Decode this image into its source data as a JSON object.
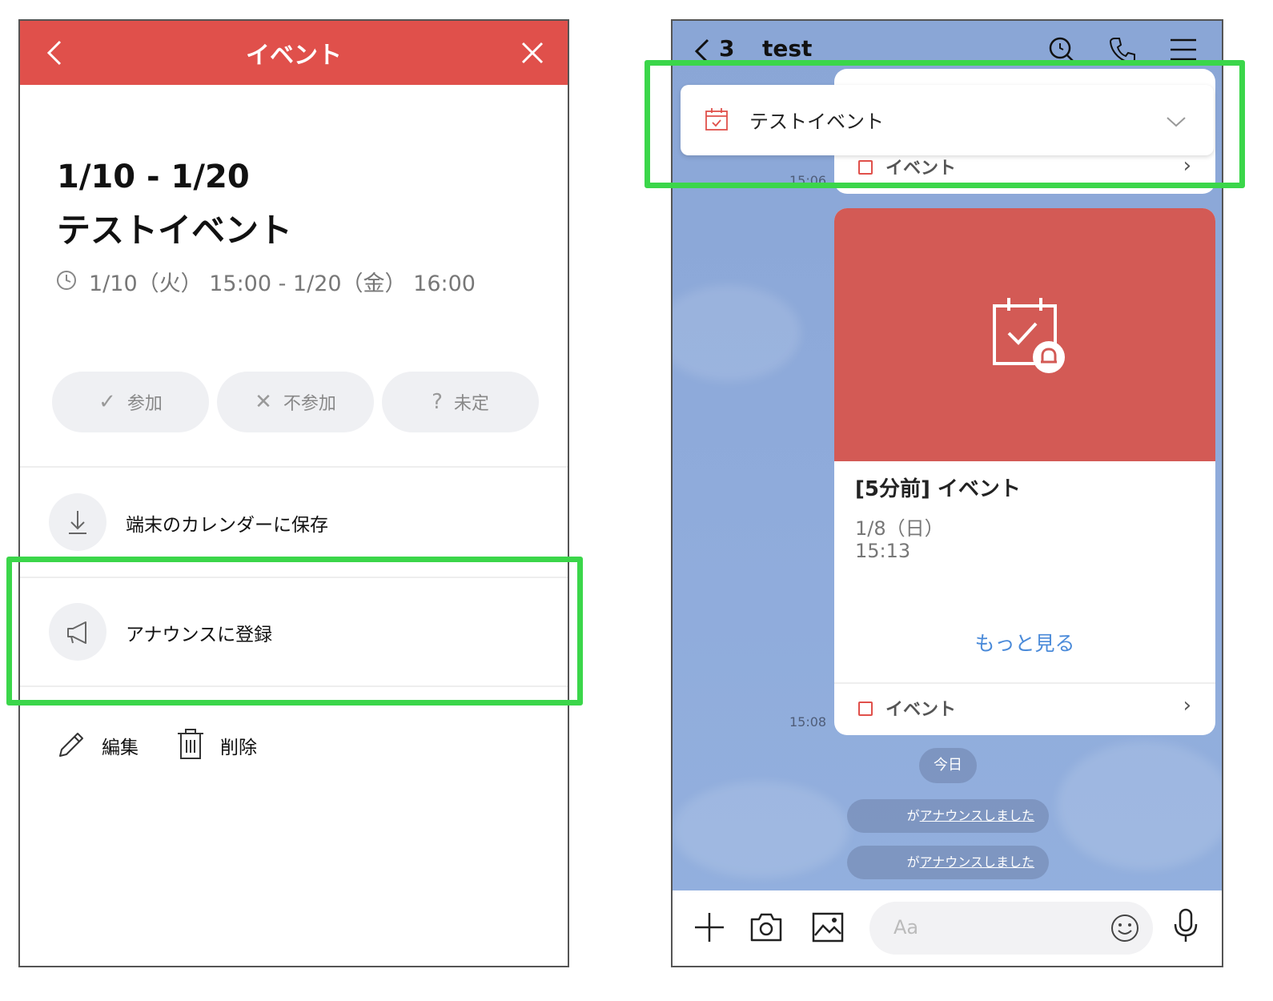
{
  "left": {
    "header": {
      "title": "イベント"
    },
    "event": {
      "date_range": "1/10 - 1/20",
      "title": "テストイベント",
      "datetime": "1/10（火） 15:00 - 1/20（金） 16:00"
    },
    "rsvp": [
      {
        "icon": "check-icon",
        "glyph": "✓",
        "label": "参加"
      },
      {
        "icon": "x-icon",
        "glyph": "✕",
        "label": "不参加"
      },
      {
        "icon": "question-icon",
        "glyph": "?",
        "label": "未定"
      }
    ],
    "actions": {
      "save_calendar": "端末のカレンダーに保存",
      "announce": "アナウンスに登録"
    },
    "footer": {
      "edit": "編集",
      "delete": "削除"
    }
  },
  "right": {
    "header": {
      "back_count": "3",
      "chat_name": "test"
    },
    "pinned": {
      "title": "テストイベント"
    },
    "top_bubble": {
      "timestamp": "15:06",
      "link": "イベント"
    },
    "card": {
      "title": "[5分前] イベント",
      "date": "1/8（日）",
      "time": "15:13",
      "more": "もっと見る",
      "link": "イベント",
      "timestamp": "15:08"
    },
    "today": "今日",
    "announcements": [
      {
        "prefix": "が",
        "link": "アナウンスしました"
      },
      {
        "prefix": "が",
        "link": "アナウンスしました"
      }
    ],
    "input": {
      "placeholder": "Aa"
    }
  },
  "colors": {
    "header_red": "#e0504b",
    "card_red": "#d35a55",
    "chat_bg": "#8fabdb",
    "highlight_green": "#3bd64a",
    "link_blue": "#4a8ad9"
  }
}
